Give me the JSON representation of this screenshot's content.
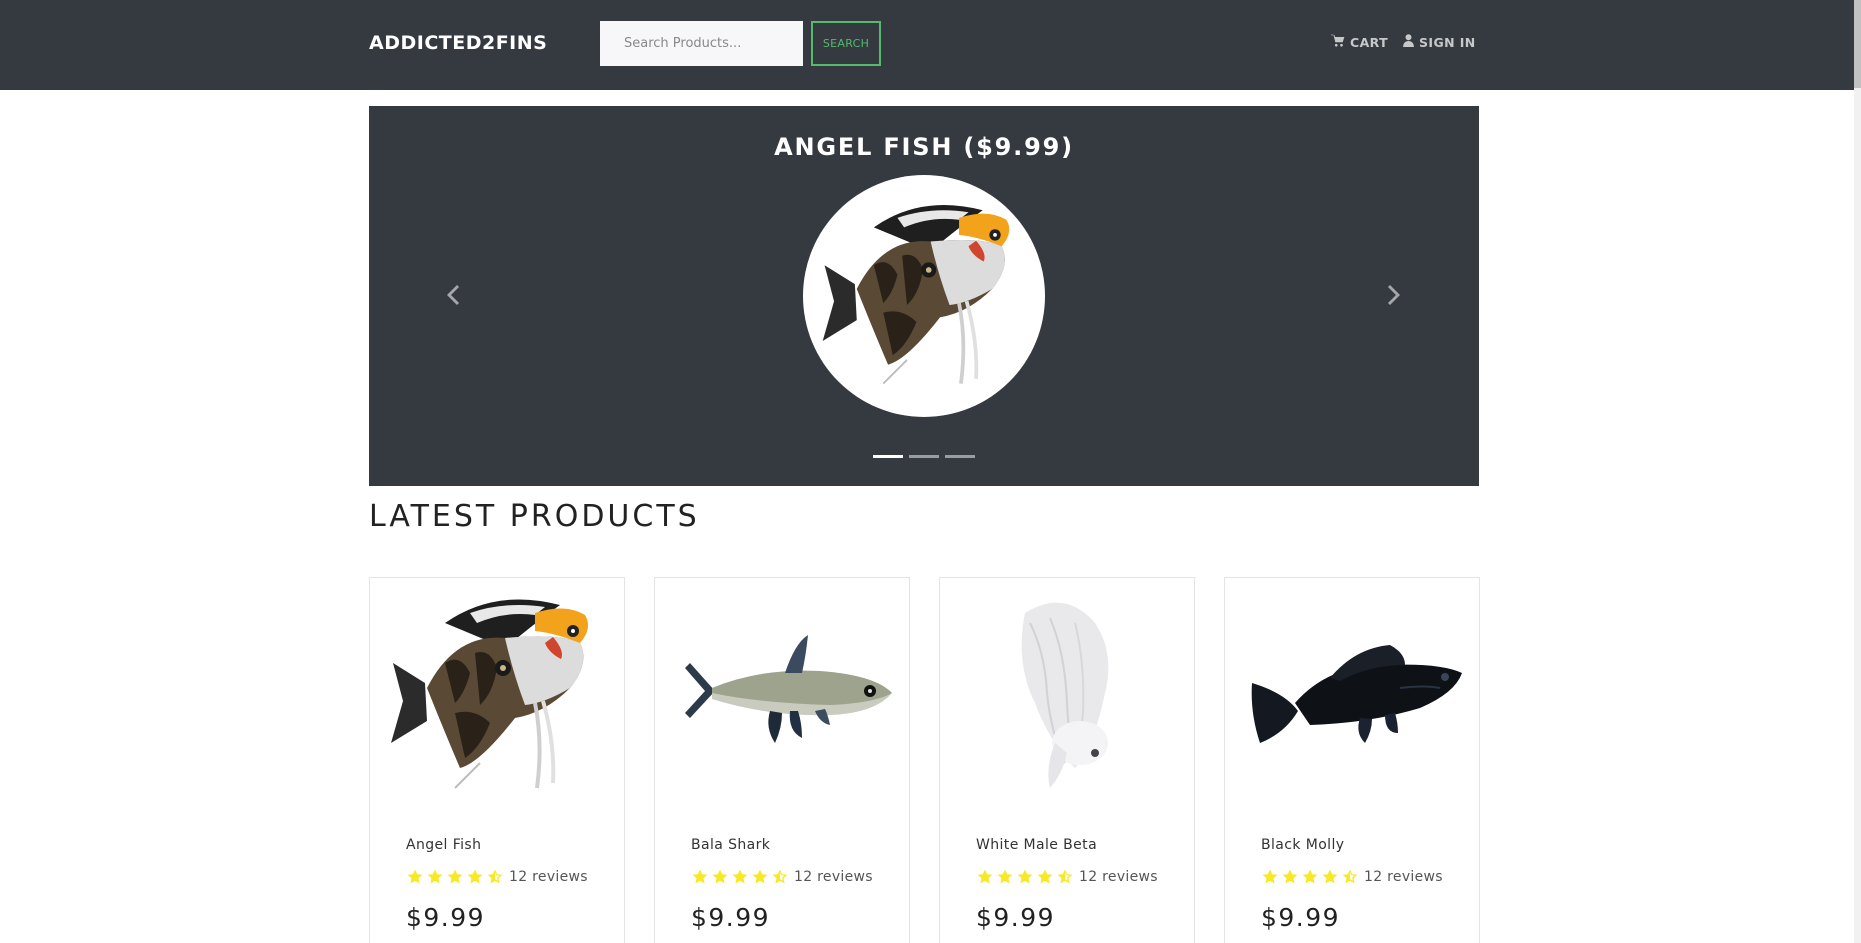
{
  "navbar": {
    "brand": "ADDICTED2FINS",
    "search_placeholder": "Search Products...",
    "search_button": "Search",
    "cart_label": "CART",
    "signin_label": "SIGN IN",
    "cart_icon": "shopping-cart-icon",
    "signin_icon": "user-icon"
  },
  "carousel": {
    "caption": "ANGEL FISH ($9.99)",
    "slide_count": 3,
    "active_index": 0,
    "prev_icon": "chevron-left-icon",
    "next_icon": "chevron-right-icon"
  },
  "section": {
    "title": "LATEST PRODUCTS"
  },
  "products": [
    {
      "name": "Angel Fish",
      "rating": 4.5,
      "reviews": "12 reviews",
      "price": "$9.99"
    },
    {
      "name": "Bala Shark",
      "rating": 4.5,
      "reviews": "12 reviews",
      "price": "$9.99"
    },
    {
      "name": "White Male Beta",
      "rating": 4.5,
      "reviews": "12 reviews",
      "price": "$9.99"
    },
    {
      "name": "Black Molly",
      "rating": 4.5,
      "reviews": "12 reviews",
      "price": "$9.99"
    }
  ],
  "colors": {
    "navbar_bg": "#343a40",
    "search_accent": "#55b96e",
    "star": "#f8e825"
  }
}
